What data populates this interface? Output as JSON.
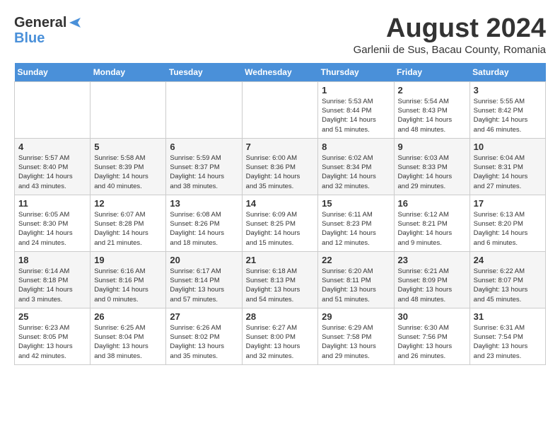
{
  "header": {
    "logo_general": "General",
    "logo_blue": "Blue",
    "month_title": "August 2024",
    "subtitle": "Garlenii de Sus, Bacau County, Romania"
  },
  "days_of_week": [
    "Sunday",
    "Monday",
    "Tuesday",
    "Wednesday",
    "Thursday",
    "Friday",
    "Saturday"
  ],
  "weeks": [
    [
      {
        "day": "",
        "info": ""
      },
      {
        "day": "",
        "info": ""
      },
      {
        "day": "",
        "info": ""
      },
      {
        "day": "",
        "info": ""
      },
      {
        "day": "1",
        "info": "Sunrise: 5:53 AM\nSunset: 8:44 PM\nDaylight: 14 hours\nand 51 minutes."
      },
      {
        "day": "2",
        "info": "Sunrise: 5:54 AM\nSunset: 8:43 PM\nDaylight: 14 hours\nand 48 minutes."
      },
      {
        "day": "3",
        "info": "Sunrise: 5:55 AM\nSunset: 8:42 PM\nDaylight: 14 hours\nand 46 minutes."
      }
    ],
    [
      {
        "day": "4",
        "info": "Sunrise: 5:57 AM\nSunset: 8:40 PM\nDaylight: 14 hours\nand 43 minutes."
      },
      {
        "day": "5",
        "info": "Sunrise: 5:58 AM\nSunset: 8:39 PM\nDaylight: 14 hours\nand 40 minutes."
      },
      {
        "day": "6",
        "info": "Sunrise: 5:59 AM\nSunset: 8:37 PM\nDaylight: 14 hours\nand 38 minutes."
      },
      {
        "day": "7",
        "info": "Sunrise: 6:00 AM\nSunset: 8:36 PM\nDaylight: 14 hours\nand 35 minutes."
      },
      {
        "day": "8",
        "info": "Sunrise: 6:02 AM\nSunset: 8:34 PM\nDaylight: 14 hours\nand 32 minutes."
      },
      {
        "day": "9",
        "info": "Sunrise: 6:03 AM\nSunset: 8:33 PM\nDaylight: 14 hours\nand 29 minutes."
      },
      {
        "day": "10",
        "info": "Sunrise: 6:04 AM\nSunset: 8:31 PM\nDaylight: 14 hours\nand 27 minutes."
      }
    ],
    [
      {
        "day": "11",
        "info": "Sunrise: 6:05 AM\nSunset: 8:30 PM\nDaylight: 14 hours\nand 24 minutes."
      },
      {
        "day": "12",
        "info": "Sunrise: 6:07 AM\nSunset: 8:28 PM\nDaylight: 14 hours\nand 21 minutes."
      },
      {
        "day": "13",
        "info": "Sunrise: 6:08 AM\nSunset: 8:26 PM\nDaylight: 14 hours\nand 18 minutes."
      },
      {
        "day": "14",
        "info": "Sunrise: 6:09 AM\nSunset: 8:25 PM\nDaylight: 14 hours\nand 15 minutes."
      },
      {
        "day": "15",
        "info": "Sunrise: 6:11 AM\nSunset: 8:23 PM\nDaylight: 14 hours\nand 12 minutes."
      },
      {
        "day": "16",
        "info": "Sunrise: 6:12 AM\nSunset: 8:21 PM\nDaylight: 14 hours\nand 9 minutes."
      },
      {
        "day": "17",
        "info": "Sunrise: 6:13 AM\nSunset: 8:20 PM\nDaylight: 14 hours\nand 6 minutes."
      }
    ],
    [
      {
        "day": "18",
        "info": "Sunrise: 6:14 AM\nSunset: 8:18 PM\nDaylight: 14 hours\nand 3 minutes."
      },
      {
        "day": "19",
        "info": "Sunrise: 6:16 AM\nSunset: 8:16 PM\nDaylight: 14 hours\nand 0 minutes."
      },
      {
        "day": "20",
        "info": "Sunrise: 6:17 AM\nSunset: 8:14 PM\nDaylight: 13 hours\nand 57 minutes."
      },
      {
        "day": "21",
        "info": "Sunrise: 6:18 AM\nSunset: 8:13 PM\nDaylight: 13 hours\nand 54 minutes."
      },
      {
        "day": "22",
        "info": "Sunrise: 6:20 AM\nSunset: 8:11 PM\nDaylight: 13 hours\nand 51 minutes."
      },
      {
        "day": "23",
        "info": "Sunrise: 6:21 AM\nSunset: 8:09 PM\nDaylight: 13 hours\nand 48 minutes."
      },
      {
        "day": "24",
        "info": "Sunrise: 6:22 AM\nSunset: 8:07 PM\nDaylight: 13 hours\nand 45 minutes."
      }
    ],
    [
      {
        "day": "25",
        "info": "Sunrise: 6:23 AM\nSunset: 8:05 PM\nDaylight: 13 hours\nand 42 minutes."
      },
      {
        "day": "26",
        "info": "Sunrise: 6:25 AM\nSunset: 8:04 PM\nDaylight: 13 hours\nand 38 minutes."
      },
      {
        "day": "27",
        "info": "Sunrise: 6:26 AM\nSunset: 8:02 PM\nDaylight: 13 hours\nand 35 minutes."
      },
      {
        "day": "28",
        "info": "Sunrise: 6:27 AM\nSunset: 8:00 PM\nDaylight: 13 hours\nand 32 minutes."
      },
      {
        "day": "29",
        "info": "Sunrise: 6:29 AM\nSunset: 7:58 PM\nDaylight: 13 hours\nand 29 minutes."
      },
      {
        "day": "30",
        "info": "Sunrise: 6:30 AM\nSunset: 7:56 PM\nDaylight: 13 hours\nand 26 minutes."
      },
      {
        "day": "31",
        "info": "Sunrise: 6:31 AM\nSunset: 7:54 PM\nDaylight: 13 hours\nand 23 minutes."
      }
    ]
  ]
}
